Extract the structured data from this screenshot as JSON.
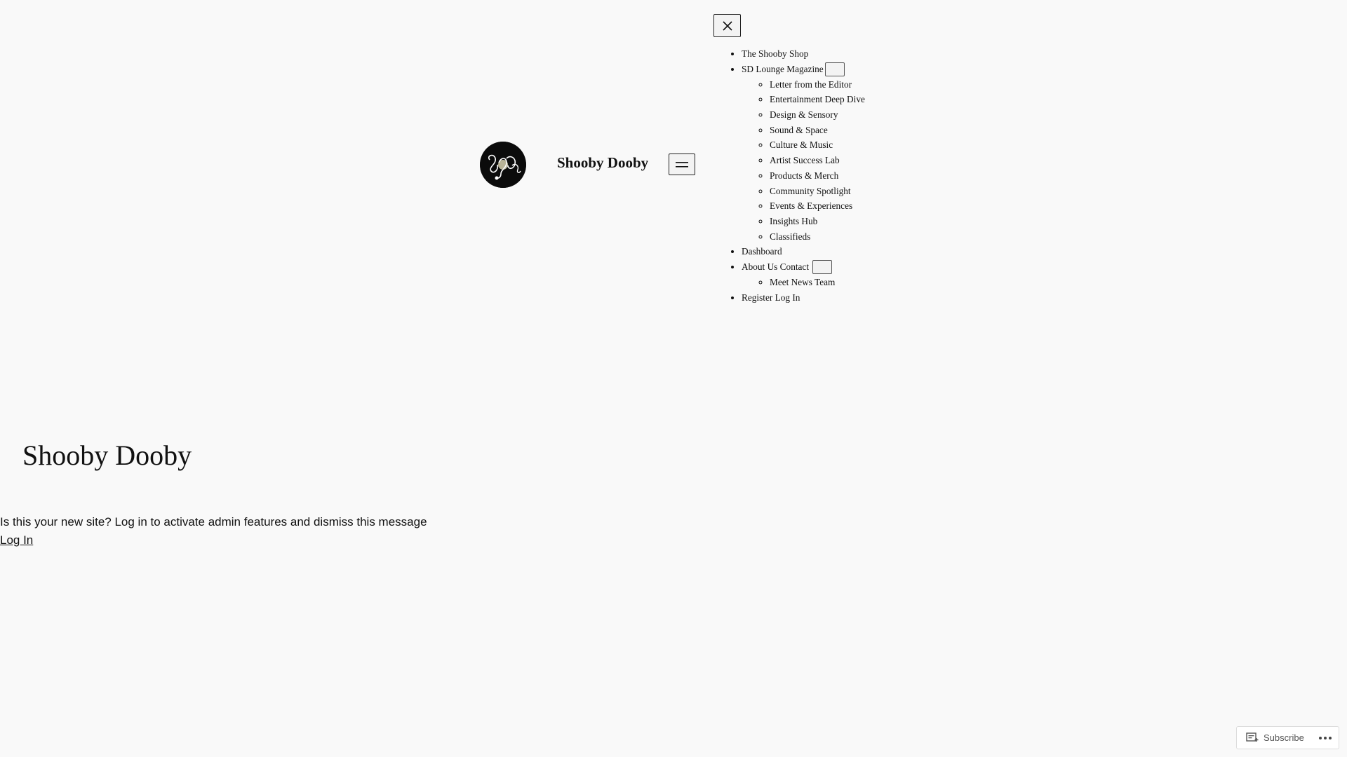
{
  "header": {
    "site_title": "Shooby Dooby",
    "menu_button_icon": "hamburger-icon",
    "close_button_icon": "close-icon"
  },
  "nav": {
    "items": [
      {
        "label": "The Shooby Shop"
      },
      {
        "label": "SD Lounge Magazine",
        "has_submenu": true,
        "children": [
          "Letter from the Editor",
          "Entertainment Deep Dive",
          "Design & Sensory",
          "Sound & Space",
          "Culture & Music",
          "Artist Success Lab",
          "Products & Merch",
          "Community Spotlight",
          "Events & Experiences",
          "Insights Hub",
          "Classifieds"
        ]
      },
      {
        "label": "Dashboard"
      },
      {
        "label_a": "About Us",
        "label_b": "Contact",
        "has_submenu": true,
        "children": [
          "Meet News Team"
        ]
      },
      {
        "label_a": "Register",
        "label_b": "Log In"
      }
    ]
  },
  "main": {
    "title": "Shooby Dooby"
  },
  "notice": {
    "message": "Is this your new site? Log in to activate admin features and dismiss this message",
    "login_link": "Log In"
  },
  "subscribe_bar": {
    "subscribe_label": "Subscribe",
    "subscribe_icon": "reader-subscribe-icon",
    "more_icon": "ellipsis-icon"
  }
}
